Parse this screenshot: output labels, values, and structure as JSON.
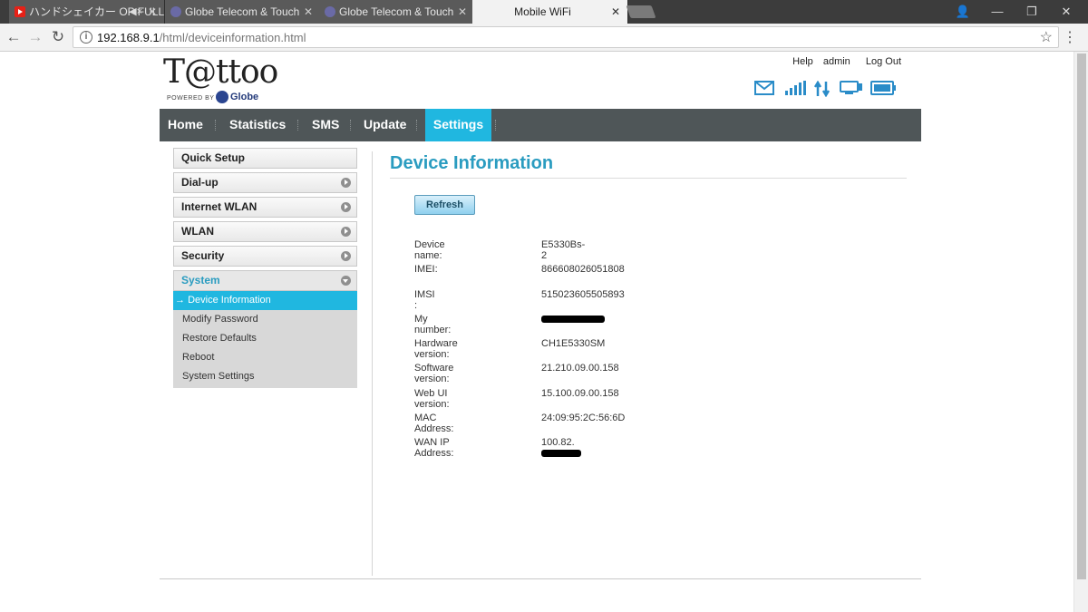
{
  "browser": {
    "tabs": [
      {
        "title": "ハンドシェイカー OP FULL",
        "favicon": "youtube-icon",
        "muted": true
      },
      {
        "title": "Globe Telecom & Touch",
        "favicon": "globe-icon"
      },
      {
        "title": "Globe Telecom & Touch",
        "favicon": "globe-icon"
      },
      {
        "title": "Mobile WiFi",
        "active": true
      }
    ],
    "url_host": "192.168.9.1",
    "url_path": "/html/deviceinformation.html"
  },
  "header": {
    "logo_text": "T@ttoo",
    "logo_powered": "POWERED BY",
    "logo_brand": "Globe",
    "links": {
      "help": "Help",
      "admin": "admin",
      "logout": "Log Out"
    },
    "status_icons": [
      "mail-icon",
      "signal-icon",
      "data-transfer-icon",
      "wifi-device-icon",
      "battery-icon"
    ]
  },
  "nav": {
    "items": [
      "Home",
      "Statistics",
      "SMS",
      "Update",
      "Settings"
    ],
    "active": "Settings"
  },
  "sidebar": {
    "items": [
      {
        "label": "Quick Setup"
      },
      {
        "label": "Dial-up"
      },
      {
        "label": "Internet WLAN"
      },
      {
        "label": "WLAN"
      },
      {
        "label": "Security"
      },
      {
        "label": "System"
      }
    ],
    "submenu": [
      {
        "label": "Device Information",
        "active": true
      },
      {
        "label": "Modify Password"
      },
      {
        "label": "Restore Defaults"
      },
      {
        "label": "Reboot"
      },
      {
        "label": "System Settings"
      }
    ]
  },
  "main": {
    "title": "Device Information",
    "refresh_label": "Refresh",
    "rows": [
      {
        "label": "Device name:",
        "value": "E5330Bs-2"
      },
      {
        "label": "IMEI:",
        "value": "866608026051808"
      },
      {
        "label": "IMSI :",
        "value": "515023605505893"
      },
      {
        "label": "My number:",
        "value": ""
      },
      {
        "label": "Hardware version:",
        "value": "CH1E5330SM"
      },
      {
        "label": "Software version:",
        "value": "21.210.09.00.158"
      },
      {
        "label": "Web UI version:",
        "value": "15.100.09.00.158"
      },
      {
        "label": "MAC Address:",
        "value": "24:09:95:2C:56:6D"
      },
      {
        "label": "WAN IP Address:",
        "value": "100.82."
      }
    ]
  },
  "colors": {
    "accent": "#20b7e0",
    "title": "#2a9cc0",
    "nav_bg": "#4f5658"
  }
}
